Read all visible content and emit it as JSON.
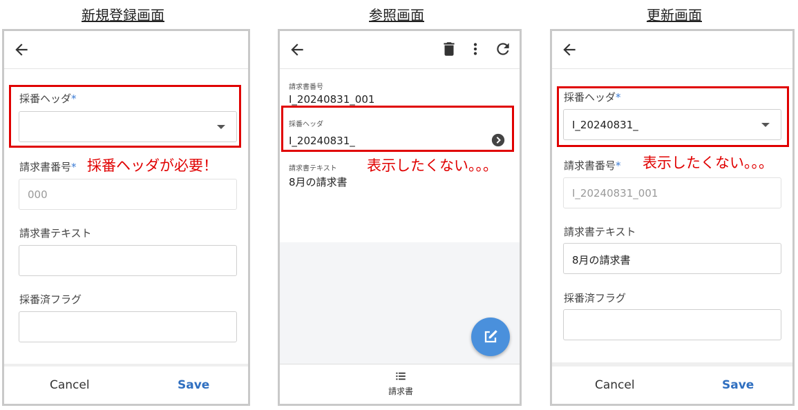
{
  "titles": {
    "create": "新規登録画面",
    "view": "参照画面",
    "update": "更新画面"
  },
  "create": {
    "numbering_header_label": "採番ヘッダ",
    "required_mark": "*",
    "numbering_header_value": "",
    "invoice_no_label": "請求書番号",
    "invoice_no_placeholder": "000",
    "invoice_text_label": "請求書テキスト",
    "invoice_text_value": "",
    "numbered_flag_label": "採番済フラグ",
    "numbered_flag_value": "",
    "note": "採番ヘッダが必要！",
    "cancel": "Cancel",
    "save": "Save"
  },
  "view": {
    "invoice_no_label": "請求書番号",
    "invoice_no_value": "I_20240831_001",
    "numbering_header_label": "採番ヘッダ",
    "numbering_header_value": "I_20240831_",
    "invoice_text_label": "請求書テキスト",
    "invoice_text_value": "8月の請求書",
    "note": "表示したくない。。。",
    "nav_label": "請求書"
  },
  "update": {
    "numbering_header_label": "採番ヘッダ",
    "required_mark": "*",
    "numbering_header_value": "I_20240831_",
    "invoice_no_label": "請求書番号",
    "invoice_no_value": "I_20240831_001",
    "invoice_text_label": "請求書テキスト",
    "invoice_text_value": "8月の請求書",
    "numbered_flag_label": "採番済フラグ",
    "numbered_flag_value": "",
    "note": "表示したくない。。。",
    "cancel": "Cancel",
    "save": "Save"
  },
  "icons": [
    "arrow-back-icon",
    "trash-icon",
    "more-vert-icon",
    "refresh-icon",
    "chevron-circle-right-icon",
    "edit-icon",
    "list-icon"
  ],
  "colors": {
    "required": "#3b7bd4",
    "highlight": "#e00000",
    "save": "#2f6fc0",
    "fab": "#4a90dc"
  }
}
